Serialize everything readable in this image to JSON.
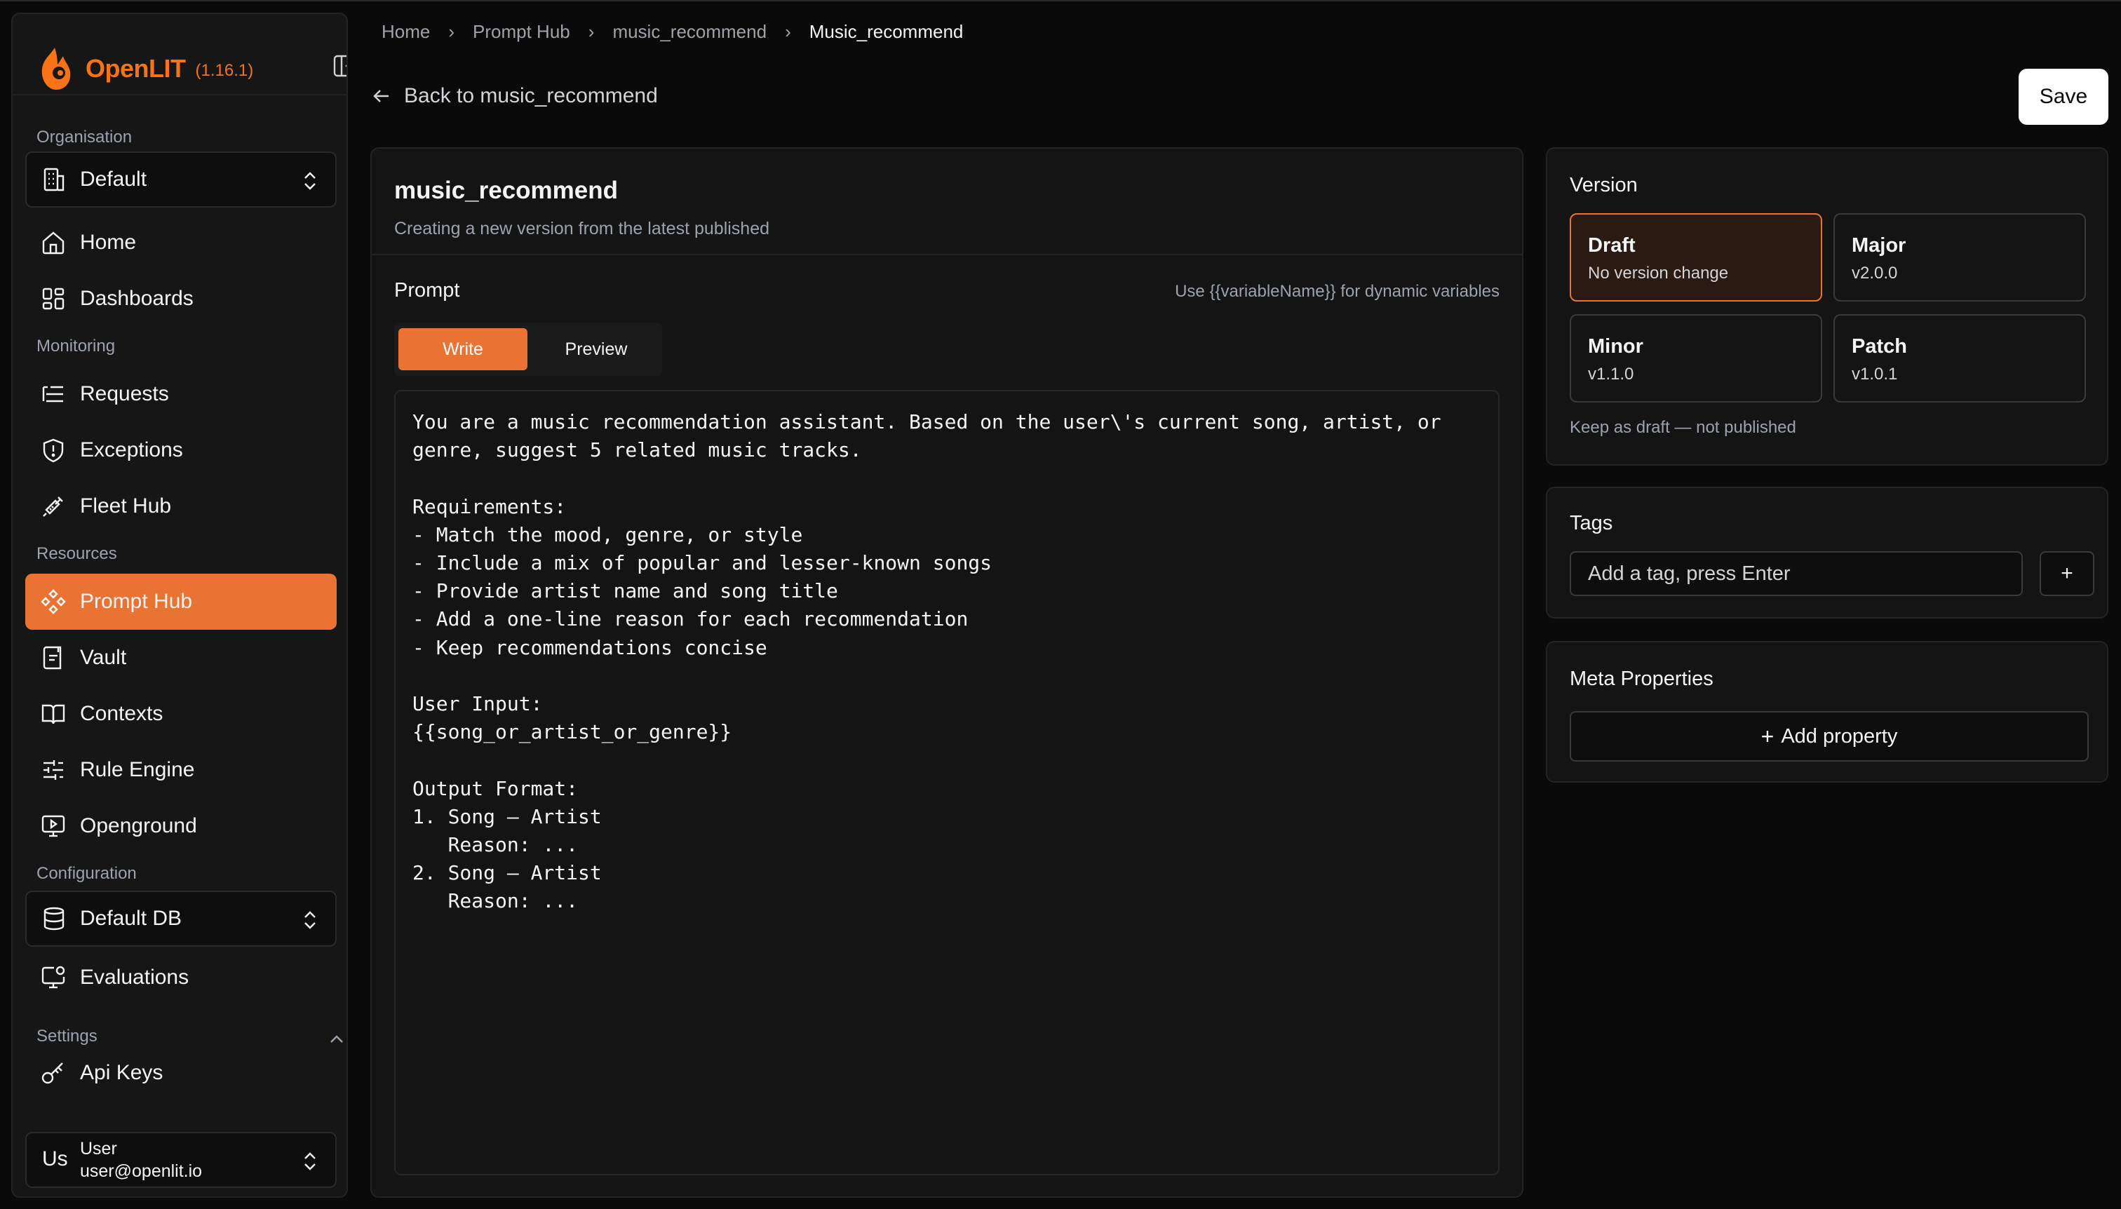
{
  "brand": {
    "name": "OpenLIT",
    "version": "(1.16.1)",
    "color": "#f97316"
  },
  "sidebar": {
    "organisation_label": "Organisation",
    "organisation_select": "Default",
    "monitoring_label": "Monitoring",
    "resources_label": "Resources",
    "configuration_label": "Configuration",
    "settings_label": "Settings",
    "database_select": "Default DB",
    "items": {
      "home": "Home",
      "dashboards": "Dashboards",
      "requests": "Requests",
      "exceptions": "Exceptions",
      "fleet_hub": "Fleet Hub",
      "prompt_hub": "Prompt Hub",
      "vault": "Vault",
      "contexts": "Contexts",
      "rule_engine": "Rule Engine",
      "openground": "Openground",
      "evaluations": "Evaluations",
      "api_keys": "Api Keys"
    },
    "active_item": "prompt_hub",
    "active_color": "#ea7333",
    "user": {
      "initials": "Us",
      "name": "User",
      "email": "user@openlit.io"
    }
  },
  "breadcrumb": [
    "Home",
    "Prompt Hub",
    "music_recommend",
    "Music_recommend"
  ],
  "header": {
    "back_label": "Back to music_recommend",
    "save_label": "Save"
  },
  "editor": {
    "prompt_name": "music_recommend",
    "subtitle": "Creating a new version from the latest published",
    "prompt_label": "Prompt",
    "hint": "Use {{variableName}} for dynamic variables",
    "tabs": {
      "write": "Write",
      "preview": "Preview"
    },
    "active_tab": "write",
    "prompt_text": "You are a music recommendation assistant. Based on the user\\'s current song, artist, or\ngenre, suggest 5 related music tracks.\n\nRequirements:\n- Match the mood, genre, or style\n- Include a mix of popular and lesser-known songs\n- Provide artist name and song title\n- Add a one-line reason for each recommendation\n- Keep recommendations concise\n\nUser Input:\n{{song_or_artist_or_genre}}\n\nOutput Format:\n1. Song – Artist\n   Reason: ...\n2. Song – Artist\n   Reason: ..."
  },
  "version_panel": {
    "title": "Version",
    "options": {
      "draft": {
        "title": "Draft",
        "sub": "No version change"
      },
      "major": {
        "title": "Major",
        "sub": "v2.0.0"
      },
      "minor": {
        "title": "Minor",
        "sub": "v1.1.0"
      },
      "patch": {
        "title": "Patch",
        "sub": "v1.0.1"
      }
    },
    "selected": "draft",
    "note": "Keep as draft — not published"
  },
  "tags_panel": {
    "title": "Tags",
    "placeholder": "Add a tag, press Enter",
    "add_label": "+"
  },
  "meta_panel": {
    "title": "Meta Properties",
    "add_label": "Add property"
  }
}
